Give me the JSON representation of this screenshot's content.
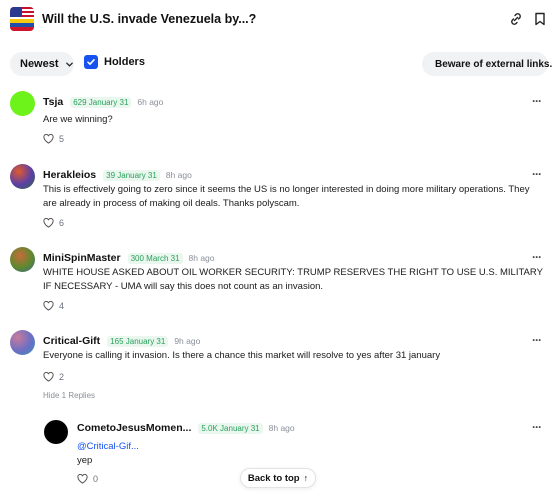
{
  "header": {
    "title": "Will the U.S. invade Venezuela by...?",
    "flag_icon": "us-venezuela-flag-icon",
    "link_icon": "link-icon",
    "bookmark_icon": "bookmark-icon"
  },
  "filters": {
    "sort_label": "Newest",
    "holders_label": "Holders",
    "holders_checked": true,
    "beware_label": "Beware of external links."
  },
  "comments": [
    {
      "user": "Tsja",
      "badge": "629 January 31",
      "time": "6h ago",
      "text": "Are we winning?",
      "likes": "5",
      "avatar_color": "#6df21a"
    },
    {
      "user": "Herakleios",
      "badge": "39 January 31",
      "time": "8h ago",
      "text": "This is effectively going to zero since it seems the US is no longer interested in doing more military operations. They are already in process of making oil deals. Thanks polyscam.",
      "likes": "6",
      "avatar_color": "#5a3fa8"
    },
    {
      "user": "MiniSpinMaster",
      "badge": "300 March 31",
      "time": "8h ago",
      "text": "WHITE HOUSE ASKED ABOUT OIL WORKER SECURITY: TRUMP RESERVES THE RIGHT TO USE U.S. MILITARY IF NECESSARY - UMA will say this does not count as an invasion.",
      "likes": "4",
      "avatar_color": "#5c8a2e"
    },
    {
      "user": "Critical-Gift",
      "badge": "165 January 31",
      "time": "9h ago",
      "text": "Everyone is calling it invasion. Is there a chance this market will resolve to yes after 31 january",
      "likes": "2",
      "avatar_color": "#6b6fc4"
    }
  ],
  "hide_replies_label": "Hide 1 Replies",
  "reply": {
    "user": "CometoJesusMomen...",
    "badge": "5.0K January 31",
    "time": "8h ago",
    "mention": "@Critical-Gif...",
    "text": "yep",
    "likes": "0"
  },
  "back_to_top_label": "Back to top",
  "colors": {
    "accent": "#1652f0",
    "badge_text": "#2aa05b",
    "badge_bg": "#e9f7ee"
  }
}
